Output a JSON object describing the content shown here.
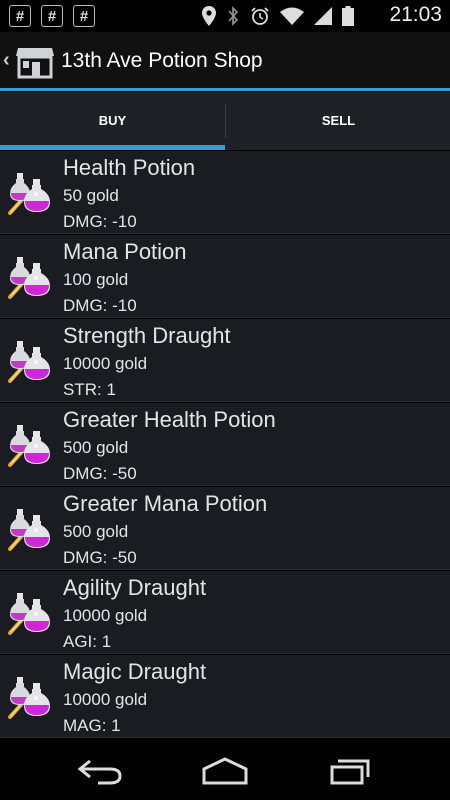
{
  "status_bar": {
    "notifications": [
      "#",
      "#",
      "#"
    ],
    "time": "21:03",
    "icons": [
      "location-icon",
      "bluetooth-icon",
      "alarm-icon",
      "wifi-icon",
      "signal-icon",
      "battery-icon"
    ]
  },
  "action_bar": {
    "title": "13th Ave Potion Shop",
    "up_icon": "back-caret-icon",
    "app_icon": "shop-icon"
  },
  "tabs": [
    {
      "label": "BUY",
      "selected": true
    },
    {
      "label": "SELL",
      "selected": false
    }
  ],
  "items": [
    {
      "name": "Health Potion",
      "price": "50 gold",
      "stat": "DMG: -10"
    },
    {
      "name": "Mana Potion",
      "price": "100 gold",
      "stat": "DMG: -10"
    },
    {
      "name": "Strength Draught",
      "price": "10000 gold",
      "stat": " STR: 1"
    },
    {
      "name": "Greater Health Potion",
      "price": "500 gold",
      "stat": "DMG: -50"
    },
    {
      "name": "Greater Mana Potion",
      "price": "500 gold",
      "stat": "DMG: -50"
    },
    {
      "name": "Agility Draught",
      "price": "10000 gold",
      "stat": " AGI: 1"
    },
    {
      "name": "Magic Draught",
      "price": "10000 gold",
      "stat": " MAG: 1"
    }
  ],
  "nav_bar": [
    "back-icon",
    "home-icon",
    "recents-icon"
  ],
  "colors": {
    "accent": "#2fa3d4",
    "row_bg": "#1a1c22",
    "tab_bg": "#1f2126"
  }
}
